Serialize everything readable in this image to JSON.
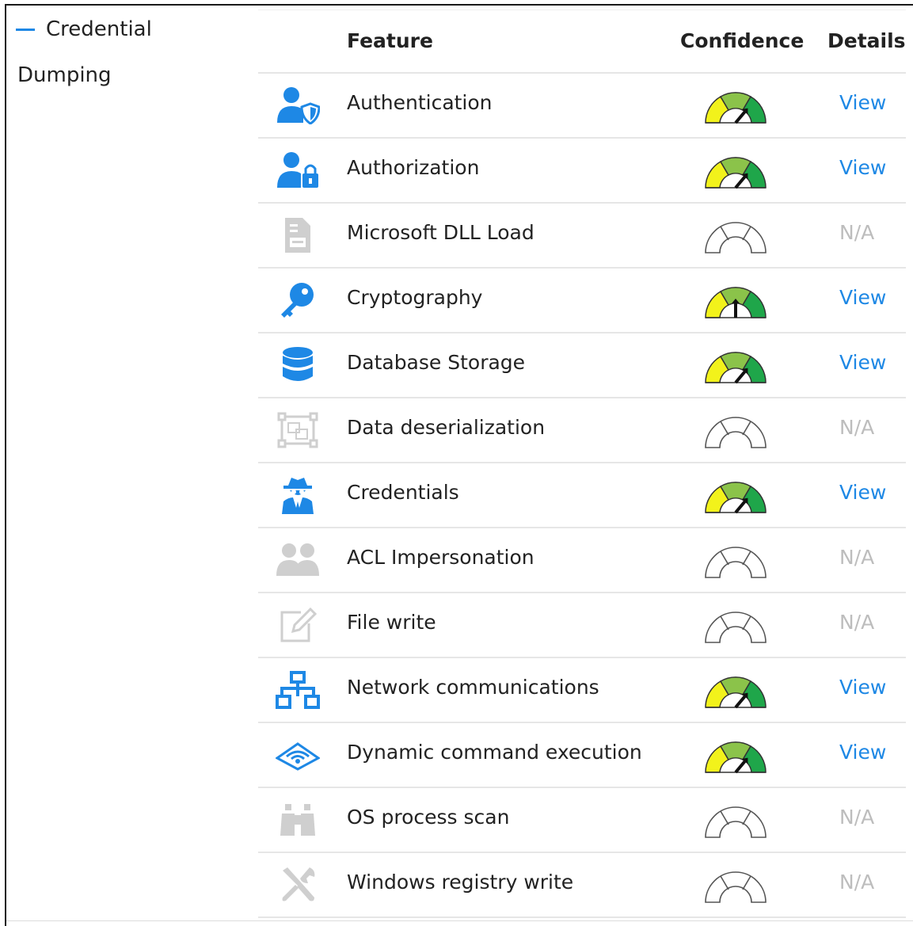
{
  "sidebar": {
    "category_line1": "Credential",
    "category_line2": "Dumping"
  },
  "table": {
    "headers": {
      "feature": "Feature",
      "confidence": "Confidence",
      "details": "Details"
    },
    "rows": [
      {
        "icon": "user-shield-icon",
        "label": "Authentication",
        "confidence": "high",
        "details": "View",
        "active": true
      },
      {
        "icon": "user-lock-icon",
        "label": "Authorization",
        "confidence": "high",
        "details": "View",
        "active": true
      },
      {
        "icon": "file-icon",
        "label": "Microsoft DLL Load",
        "confidence": "none",
        "details": "N/A",
        "active": false
      },
      {
        "icon": "key-icon",
        "label": "Cryptography",
        "confidence": "medium",
        "details": "View",
        "active": true
      },
      {
        "icon": "database-icon",
        "label": "Database Storage",
        "confidence": "high",
        "details": "View",
        "active": true
      },
      {
        "icon": "object-group-icon",
        "label": "Data deserialization",
        "confidence": "none",
        "details": "N/A",
        "active": false
      },
      {
        "icon": "user-secret-icon",
        "label": "Credentials",
        "confidence": "high",
        "details": "View",
        "active": true
      },
      {
        "icon": "users-icon",
        "label": "ACL Impersonation",
        "confidence": "none",
        "details": "N/A",
        "active": false
      },
      {
        "icon": "edit-icon",
        "label": "File write",
        "confidence": "none",
        "details": "N/A",
        "active": false
      },
      {
        "icon": "network-icon",
        "label": "Network communications",
        "confidence": "high",
        "details": "View",
        "active": true
      },
      {
        "icon": "wifi-icon",
        "label": "Dynamic command execution",
        "confidence": "high",
        "details": "View",
        "active": true
      },
      {
        "icon": "binoculars-icon",
        "label": "OS process scan",
        "confidence": "none",
        "details": "N/A",
        "active": false
      },
      {
        "icon": "tools-icon",
        "label": "Windows registry write",
        "confidence": "none",
        "details": "N/A",
        "active": false
      }
    ]
  },
  "colors": {
    "accent": "#1e88e5",
    "na_text": "#bdbdbd",
    "gauge_yellow": "#f2f21b",
    "gauge_lightgreen": "#8bc34a",
    "gauge_green": "#1fa64a"
  }
}
